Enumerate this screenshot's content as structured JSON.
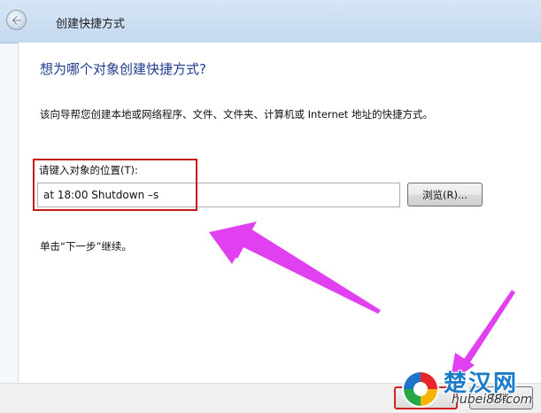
{
  "window": {
    "title": "创建快捷方式"
  },
  "page": {
    "heading": "想为哪个对象创建快捷方式?",
    "description": "该向导帮您创建本地或网络程序、文件、文件夹、计算机或 Internet 地址的快捷方式。",
    "location_label": "请键入对象的位置(T):",
    "location_value": "at 18:00 Shutdown –s",
    "browse_label": "浏览(R)...",
    "continue_hint": "单击“下一步”继续。"
  },
  "footer": {
    "next_label": "(N)",
    "cancel_label": "取消"
  },
  "watermark": {
    "site_name": "楚汉网",
    "url": "hubei88.com"
  },
  "colors": {
    "heading": "#1f3b8c",
    "highlight": "#c41a1a",
    "arrow": "#e040f0"
  }
}
